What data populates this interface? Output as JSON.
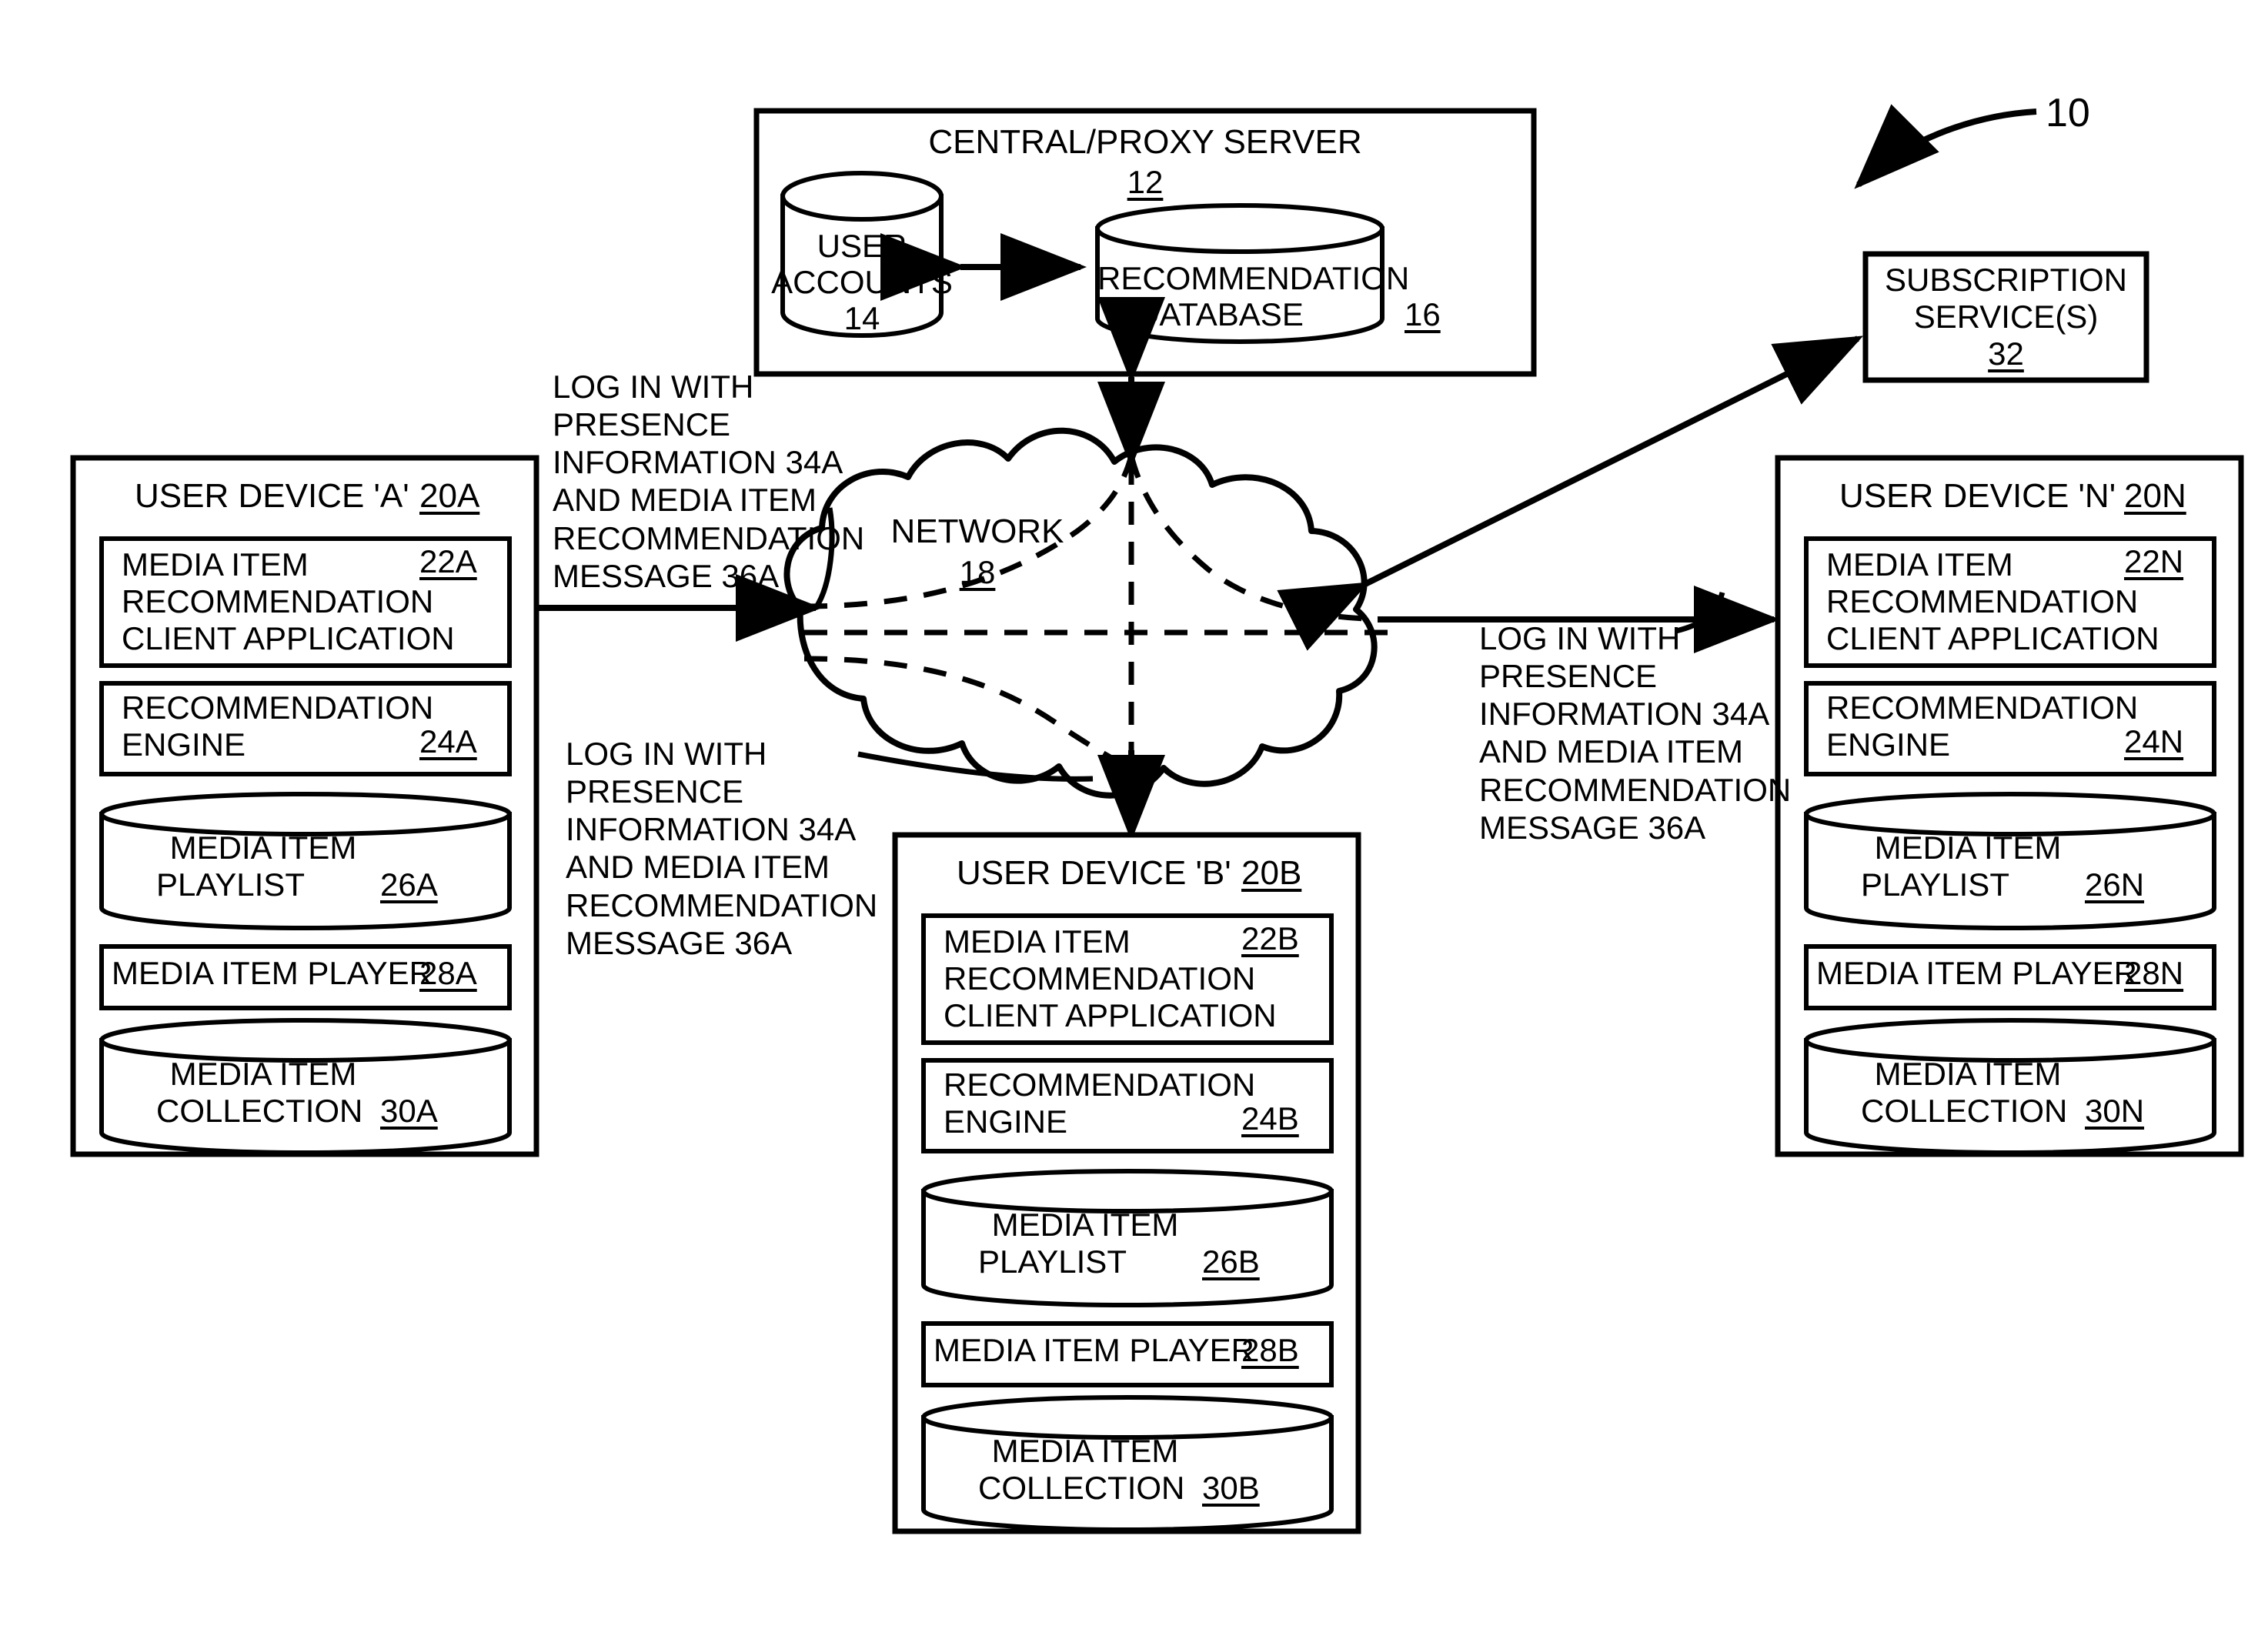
{
  "figure": {
    "ref_label": "10"
  },
  "server": {
    "title": "CENTRAL/PROXY SERVER",
    "ref": "12",
    "user_accounts": {
      "line1": "USER",
      "line2": "ACCOUNTS",
      "ref": "14"
    },
    "recommendation_db": {
      "line1": "RECOMMENDATION",
      "line2": "DATABASE",
      "ref": "16"
    }
  },
  "network": {
    "title": "NETWORK",
    "ref": "18"
  },
  "subscription": {
    "line1": "SUBSCRIPTION",
    "line2": "SERVICE(S)",
    "ref": "32"
  },
  "device_a": {
    "title": "USER DEVICE 'A'",
    "ref": "20A",
    "client_app": {
      "l1": "MEDIA ITEM",
      "l2": "RECOMMENDATION",
      "l3": "CLIENT APPLICATION",
      "ref": "22A"
    },
    "engine": {
      "l1": "RECOMMENDATION",
      "l2": "ENGINE",
      "ref": "24A"
    },
    "playlist": {
      "l1": "MEDIA ITEM",
      "l2": "PLAYLIST",
      "ref": "26A"
    },
    "player": {
      "l1": "MEDIA ITEM PLAYER",
      "ref": "28A"
    },
    "collection": {
      "l1": "MEDIA ITEM",
      "l2": "COLLECTION",
      "ref": "30A"
    }
  },
  "device_b": {
    "title": "USER DEVICE 'B'",
    "ref": "20B",
    "client_app": {
      "l1": "MEDIA ITEM",
      "l2": "RECOMMENDATION",
      "l3": "CLIENT APPLICATION",
      "ref": "22B"
    },
    "engine": {
      "l1": "RECOMMENDATION",
      "l2": "ENGINE",
      "ref": "24B"
    },
    "playlist": {
      "l1": "MEDIA ITEM",
      "l2": "PLAYLIST",
      "ref": "26B"
    },
    "player": {
      "l1": "MEDIA ITEM PLAYER",
      "ref": "28B"
    },
    "collection": {
      "l1": "MEDIA ITEM",
      "l2": "COLLECTION",
      "ref": "30B"
    }
  },
  "device_n": {
    "title": "USER DEVICE 'N'",
    "ref": "20N",
    "client_app": {
      "l1": "MEDIA ITEM",
      "l2": "RECOMMENDATION",
      "l3": "CLIENT APPLICATION",
      "ref": "22N"
    },
    "engine": {
      "l1": "RECOMMENDATION",
      "l2": "ENGINE",
      "ref": "24N"
    },
    "playlist": {
      "l1": "MEDIA ITEM",
      "l2": "PLAYLIST",
      "ref": "26N"
    },
    "player": {
      "l1": "MEDIA ITEM PLAYER",
      "ref": "28N"
    },
    "collection": {
      "l1": "MEDIA ITEM",
      "l2": "COLLECTION",
      "ref": "30N"
    }
  },
  "annotations": {
    "a_to_network": "LOG IN WITH\nPRESENCE\nINFORMATION 34A\nAND MEDIA ITEM\nRECOMMENDATION\nMESSAGE 36A",
    "network_to_b": "LOG IN WITH\nPRESENCE\nINFORMATION 34A\nAND MEDIA ITEM\nRECOMMENDATION\nMESSAGE 36A",
    "network_to_n": "LOG IN WITH\nPRESENCE\nINFORMATION 34A\nAND MEDIA ITEM\nRECOMMENDATION\nMESSAGE 36A"
  },
  "colors": {
    "ink": "#000000",
    "paper": "#ffffff"
  }
}
